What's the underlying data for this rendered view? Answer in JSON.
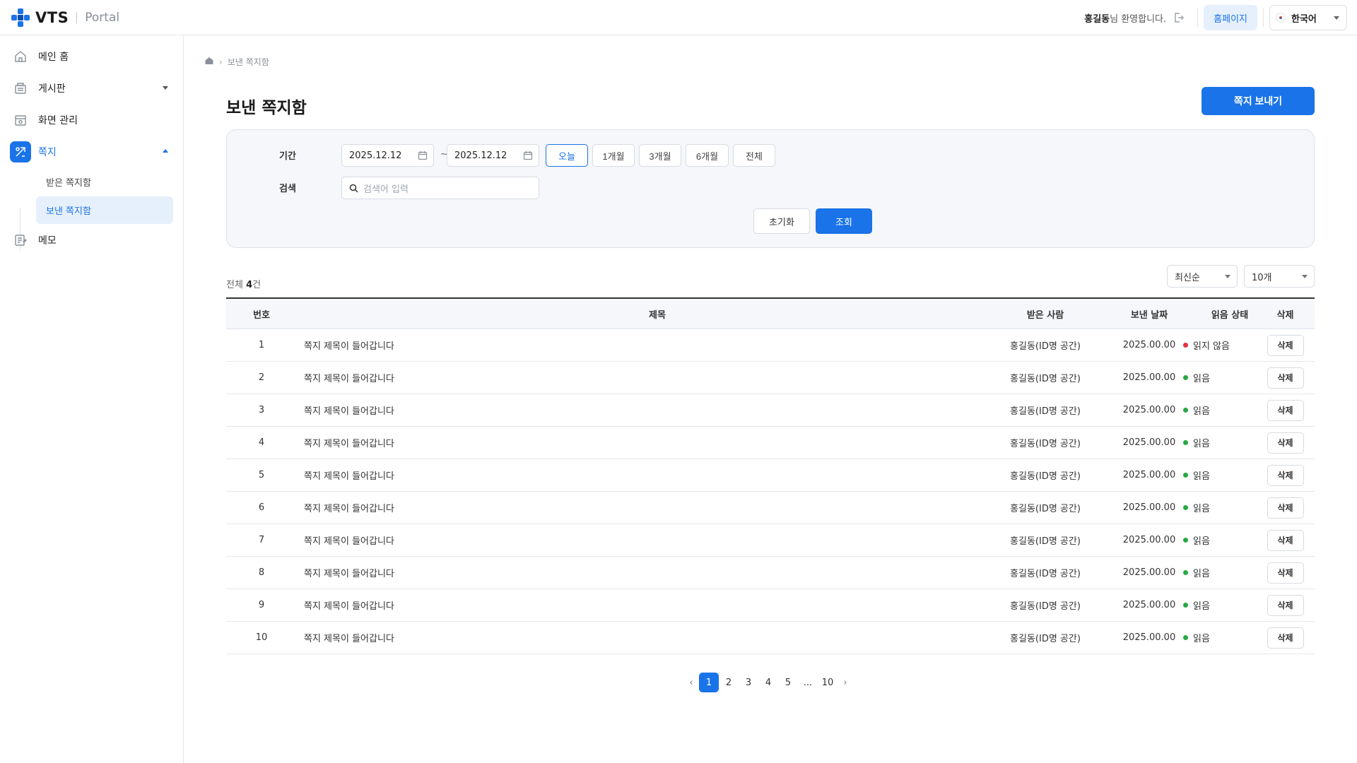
{
  "header": {
    "logo_text": "VTS",
    "logo_sub": "Portal",
    "welcome_name": "홍길동",
    "welcome_suffix": "님 환영합니다.",
    "homepage_label": "홈페이지",
    "language": "한국어",
    "accent_color": "#1a73e8"
  },
  "sidebar": {
    "items": [
      {
        "label": "메인 홈",
        "icon": "home-icon"
      },
      {
        "label": "게시판",
        "icon": "board-icon"
      },
      {
        "label": "화면 관리",
        "icon": "screen-manage-icon"
      },
      {
        "label": "쪽지",
        "icon": "message-icon"
      },
      {
        "label": "메모",
        "icon": "memo-icon"
      }
    ],
    "sub_items": [
      {
        "label": "받은 쪽지함"
      },
      {
        "label": "보낸 쪽지함"
      }
    ]
  },
  "breadcrumb": {
    "current": "보낸 쪽지함"
  },
  "page": {
    "title": "보낸 쪽지함",
    "send_button": "쪽지 보내기"
  },
  "filter": {
    "period_label": "기간",
    "start_date": "2025.12.12",
    "end_date": "2025.12.12",
    "tilde": "~",
    "periods": [
      "오늘",
      "1개월",
      "3개월",
      "6개월",
      "전체"
    ],
    "search_label": "검색",
    "search_placeholder": "검색어 입력",
    "reset_label": "초기화",
    "query_label": "조회"
  },
  "list": {
    "total_prefix": "전체 ",
    "total_count": "4",
    "total_suffix": "건",
    "sort_value": "최신순",
    "page_size_value": "10개",
    "columns": [
      "번호",
      "제목",
      "받은 사람",
      "보낸 날짜",
      "읽음 상태",
      "삭제"
    ],
    "rows": [
      {
        "no": "1",
        "title": "쪽지 제목이 들어갑니다",
        "recipient": "홍길동(ID명 공간)",
        "date": "2025.00.00",
        "status": "읽지 않음",
        "status_color": "#e5323e",
        "delete": "삭제"
      },
      {
        "no": "2",
        "title": "쪽지 제목이 들어갑니다",
        "recipient": "홍길동(ID명 공간)",
        "date": "2025.00.00",
        "status": "읽음",
        "status_color": "#27a844",
        "delete": "삭제"
      },
      {
        "no": "3",
        "title": "쪽지 제목이 들어갑니다",
        "recipient": "홍길동(ID명 공간)",
        "date": "2025.00.00",
        "status": "읽음",
        "status_color": "#27a844",
        "delete": "삭제"
      },
      {
        "no": "4",
        "title": "쪽지 제목이 들어갑니다",
        "recipient": "홍길동(ID명 공간)",
        "date": "2025.00.00",
        "status": "읽음",
        "status_color": "#27a844",
        "delete": "삭제"
      },
      {
        "no": "5",
        "title": "쪽지 제목이 들어갑니다",
        "recipient": "홍길동(ID명 공간)",
        "date": "2025.00.00",
        "status": "읽음",
        "status_color": "#27a844",
        "delete": "삭제"
      },
      {
        "no": "6",
        "title": "쪽지 제목이 들어갑니다",
        "recipient": "홍길동(ID명 공간)",
        "date": "2025.00.00",
        "status": "읽음",
        "status_color": "#27a844",
        "delete": "삭제"
      },
      {
        "no": "7",
        "title": "쪽지 제목이 들어갑니다",
        "recipient": "홍길동(ID명 공간)",
        "date": "2025.00.00",
        "status": "읽음",
        "status_color": "#27a844",
        "delete": "삭제"
      },
      {
        "no": "8",
        "title": "쪽지 제목이 들어갑니다",
        "recipient": "홍길동(ID명 공간)",
        "date": "2025.00.00",
        "status": "읽음",
        "status_color": "#27a844",
        "delete": "삭제"
      },
      {
        "no": "9",
        "title": "쪽지 제목이 들어갑니다",
        "recipient": "홍길동(ID명 공간)",
        "date": "2025.00.00",
        "status": "읽음",
        "status_color": "#27a844",
        "delete": "삭제"
      },
      {
        "no": "10",
        "title": "쪽지 제목이 들어갑니다",
        "recipient": "홍길동(ID명 공간)",
        "date": "2025.00.00",
        "status": "읽음",
        "status_color": "#27a844",
        "delete": "삭제"
      }
    ]
  },
  "pagination": {
    "prev": "‹",
    "next": "›",
    "pages": [
      "1",
      "2",
      "3",
      "4",
      "5",
      "...",
      "10"
    ],
    "current": "1"
  }
}
